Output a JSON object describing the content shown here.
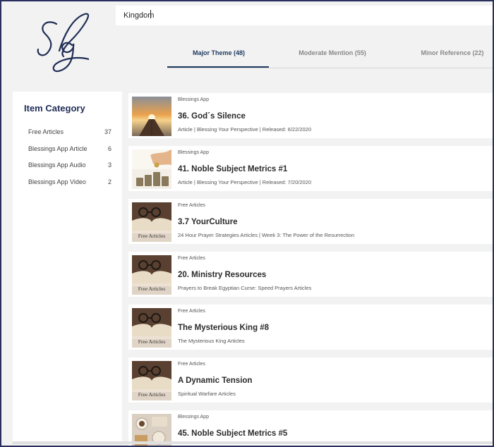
{
  "search": {
    "value": "Kingdom",
    "placeholder": ""
  },
  "logo": {
    "text": "slg"
  },
  "tabs": [
    {
      "label": "Major Theme (48)",
      "active": true
    },
    {
      "label": "Moderate Mention (55)",
      "active": false
    },
    {
      "label": "Minor Reference (22)",
      "active": false
    }
  ],
  "sidebar": {
    "title": "Item Category",
    "items": [
      {
        "label": "Free Articles",
        "count": "37"
      },
      {
        "label": "Blessings App Article",
        "count": "6"
      },
      {
        "label": "Blessings App Audio",
        "count": "3"
      },
      {
        "label": "Blessings App Video",
        "count": "2"
      }
    ]
  },
  "results": [
    {
      "category": "Blessings App",
      "title": "36. God´s Silence",
      "meta": "Article | Blessing Your Perspective | Released: 6/22/2020",
      "thumb": "pier-sunset"
    },
    {
      "category": "Blessings App",
      "title": "41. Noble Subject Metrics #1",
      "meta": "Article | Blessing Your Perspective | Released: 7/20/2020",
      "thumb": "coins-hand"
    },
    {
      "category": "Free Articles",
      "title": "3.7 YourCulture",
      "meta": "24 Hour Prayer Strategies Articles | Week 3: The Power of the Resurrection",
      "thumb": "book-glasses",
      "thumb_label": "Free Articles"
    },
    {
      "category": "Free Articles",
      "title": "20. Ministry Resources",
      "meta": "Prayers to Break Egyptian Curse: Speed Prayers Articles",
      "thumb": "book-glasses",
      "thumb_label": "Free Articles"
    },
    {
      "category": "Free Articles",
      "title": "The Mysterious King #8",
      "meta": "The Mysterious King Articles",
      "thumb": "book-glasses",
      "thumb_label": "Free Articles"
    },
    {
      "category": "Free Articles",
      "title": "A Dynamic Tension",
      "meta": "Spiritual Warfare Articles",
      "thumb": "book-glasses",
      "thumb_label": "Free Articles"
    },
    {
      "category": "Blessings App",
      "title": "45. Noble Subject Metrics #5",
      "meta": "",
      "thumb": "coffee-table"
    }
  ],
  "colors": {
    "accent": "#1f3a60",
    "sidebar_title": "#1f2d55",
    "frame": "#2b2f5e",
    "background": "#f2f2f2"
  }
}
